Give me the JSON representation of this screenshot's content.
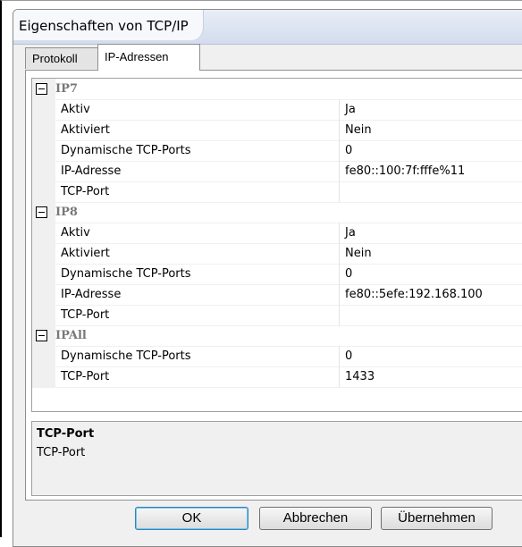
{
  "window": {
    "title": "Eigenschaften von TCP/IP"
  },
  "tabs": [
    {
      "label": "Protokoll",
      "active": false
    },
    {
      "label": "IP-Adressen",
      "active": true
    }
  ],
  "grid": {
    "rows": [
      {
        "kind": "category",
        "label": "IP7"
      },
      {
        "kind": "prop",
        "name": "Aktiv",
        "value": "Ja"
      },
      {
        "kind": "prop",
        "name": "Aktiviert",
        "value": "Nein"
      },
      {
        "kind": "prop",
        "name": "Dynamische TCP-Ports",
        "value": "0"
      },
      {
        "kind": "prop",
        "name": "IP-Adresse",
        "value": "fe80::100:7f:fffe%11"
      },
      {
        "kind": "prop",
        "name": "TCP-Port",
        "value": ""
      },
      {
        "kind": "category",
        "label": "IP8"
      },
      {
        "kind": "prop",
        "name": "Aktiv",
        "value": "Ja"
      },
      {
        "kind": "prop",
        "name": "Aktiviert",
        "value": "Nein"
      },
      {
        "kind": "prop",
        "name": "Dynamische TCP-Ports",
        "value": "0"
      },
      {
        "kind": "prop",
        "name": "IP-Adresse",
        "value": "fe80::5efe:192.168.100"
      },
      {
        "kind": "prop",
        "name": "TCP-Port",
        "value": ""
      },
      {
        "kind": "category",
        "label": "IPAll"
      },
      {
        "kind": "prop",
        "name": "Dynamische TCP-Ports",
        "value": "0"
      },
      {
        "kind": "prop",
        "name": "TCP-Port",
        "value": "1433"
      }
    ]
  },
  "description": {
    "title": "TCP-Port",
    "text": "TCP-Port"
  },
  "buttons": {
    "ok": "OK",
    "cancel": "Abbrechen",
    "apply": "Übernehmen"
  }
}
